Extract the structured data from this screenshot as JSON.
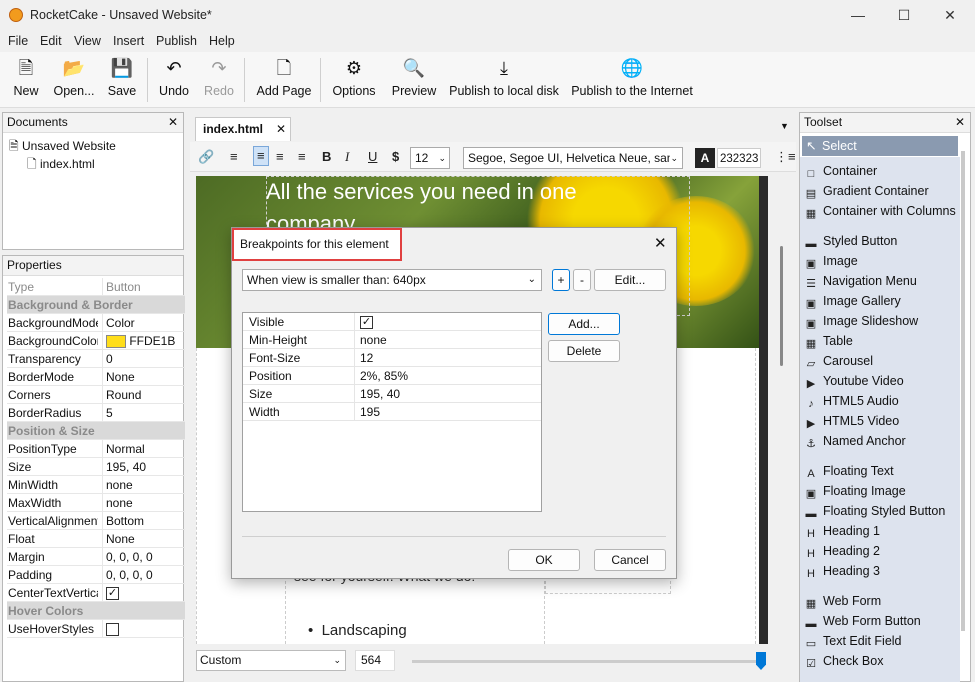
{
  "window": {
    "title": "RocketCake - Unsaved Website*"
  },
  "menu": [
    "File",
    "Edit",
    "View",
    "Insert",
    "Publish",
    "Help"
  ],
  "toolbar": {
    "new": "New",
    "open": "Open...",
    "save": "Save",
    "undo": "Undo",
    "redo": "Redo",
    "add_page": "Add Page",
    "options": "Options",
    "preview": "Preview",
    "publish_local": "Publish to local disk",
    "publish_internet": "Publish to the Internet"
  },
  "documents": {
    "title": "Documents",
    "site": "Unsaved Website",
    "page": "index.html"
  },
  "properties": {
    "title": "Properties",
    "header": {
      "key": "Type",
      "value": "Button"
    },
    "rows": [
      {
        "group": "Background & Border"
      },
      {
        "key": "BackgroundMode",
        "value": "Color"
      },
      {
        "key": "BackgroundColor",
        "value": "FFDE1B",
        "swatch": "#FFDE1B"
      },
      {
        "key": "Transparency",
        "value": "0"
      },
      {
        "key": "BorderMode",
        "value": "None"
      },
      {
        "key": "Corners",
        "value": "Round"
      },
      {
        "key": "BorderRadius",
        "value": "5"
      },
      {
        "group": "Position & Size"
      },
      {
        "key": "PositionType",
        "value": "Normal"
      },
      {
        "key": "Size",
        "value": "195, 40"
      },
      {
        "key": "MinWidth",
        "value": "none"
      },
      {
        "key": "MaxWidth",
        "value": "none"
      },
      {
        "key": "VerticalAlignment",
        "value": "Bottom"
      },
      {
        "key": "Float",
        "value": "None"
      },
      {
        "key": "Margin",
        "value": "0, 0, 0, 0"
      },
      {
        "key": "Padding",
        "value": "0, 0, 0, 0"
      },
      {
        "key": "CenterTextVertically",
        "checkbox": true,
        "checked": true
      },
      {
        "group": "Hover Colors"
      },
      {
        "key": "UseHoverStyles",
        "checkbox": true,
        "checked": false
      }
    ]
  },
  "editor": {
    "tab": "index.html",
    "font_size": "12",
    "font_family": "Segoe, Segoe UI, Helvetica Neue, san",
    "color_label": "A",
    "color_value": "232323",
    "hero_text": "All the services you need in one company",
    "body_text": "see for yourself. What we do:",
    "bullet": "Landscaping",
    "view_mode": "Custom",
    "width": "564"
  },
  "dialog": {
    "title": "Breakpoints for this element",
    "breakpoint": "When view is smaller than: 640px",
    "plus": "+",
    "minus": "-",
    "edit": "Edit...",
    "add": "Add...",
    "delete": "Delete",
    "rows": [
      {
        "key": "Visible",
        "checkbox": true
      },
      {
        "key": "Min-Height",
        "value": "none"
      },
      {
        "key": "Font-Size",
        "value": "12"
      },
      {
        "key": "Position",
        "value": "2%, 85%"
      },
      {
        "key": "Size",
        "value": "195, 40"
      },
      {
        "key": "Width",
        "value": "195"
      }
    ],
    "ok": "OK",
    "cancel": "Cancel"
  },
  "toolset": {
    "title": "Toolset",
    "selected": "Select",
    "items": [
      {
        "label": "Container",
        "icon": "container-icon"
      },
      {
        "label": "Gradient Container",
        "icon": "gradient-container-icon"
      },
      {
        "label": "Container with Columns",
        "icon": "columns-icon"
      },
      {
        "label": "Styled Button",
        "icon": "styled-button-icon"
      },
      {
        "label": "Image",
        "icon": "image-icon"
      },
      {
        "label": "Navigation Menu",
        "icon": "navigation-menu-icon"
      },
      {
        "label": "Image Gallery",
        "icon": "image-gallery-icon"
      },
      {
        "label": "Image Slideshow",
        "icon": "image-slideshow-icon"
      },
      {
        "label": "Table",
        "icon": "table-icon"
      },
      {
        "label": "Carousel",
        "icon": "carousel-icon"
      },
      {
        "label": "Youtube Video",
        "icon": "youtube-icon"
      },
      {
        "label": "HTML5 Audio",
        "icon": "audio-icon"
      },
      {
        "label": "HTML5 Video",
        "icon": "video-icon"
      },
      {
        "label": "Named Anchor",
        "icon": "anchor-icon"
      },
      {
        "label": "Floating Text",
        "icon": "floating-text-icon"
      },
      {
        "label": "Floating Image",
        "icon": "floating-image-icon"
      },
      {
        "label": "Floating Styled Button",
        "icon": "floating-button-icon"
      },
      {
        "label": "Heading 1",
        "icon": "heading1-icon"
      },
      {
        "label": "Heading 2",
        "icon": "heading2-icon"
      },
      {
        "label": "Heading 3",
        "icon": "heading3-icon"
      },
      {
        "label": "Web Form",
        "icon": "web-form-icon"
      },
      {
        "label": "Web Form Button",
        "icon": "form-button-icon"
      },
      {
        "label": "Text Edit Field",
        "icon": "text-field-icon"
      },
      {
        "label": "Check Box",
        "icon": "checkbox-icon"
      }
    ]
  },
  "colors": {
    "accent": "#0078d7",
    "highlight_border": "#e04040",
    "toolset_bg": "#dde3ee"
  }
}
